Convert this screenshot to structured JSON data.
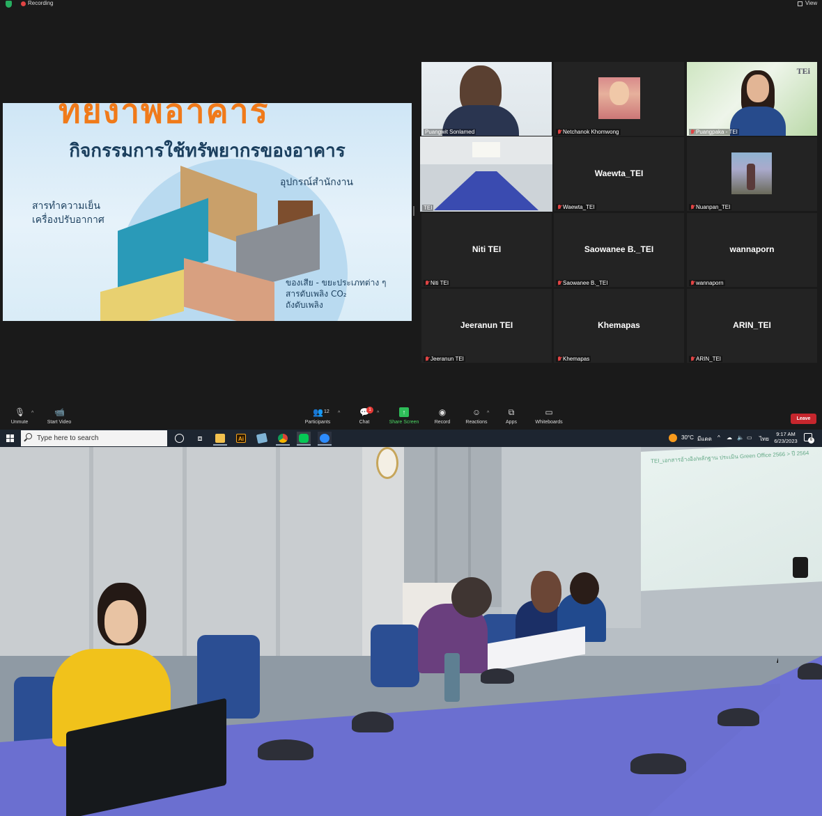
{
  "topbar": {
    "recording_label": "Recording",
    "view_label": "View"
  },
  "slide": {
    "heading": "กิจกรรมการใช้ทรัพยากรของอาคาร",
    "banner_fragment": "ทยงาพอาคาร",
    "label_office": "อุปกรณ์สำนักงาน",
    "label_refrigerant_1": "สารทำความเย็น",
    "label_refrigerant_2": "เครื่องปรับอากาศ",
    "label_waste_1": "ของเสีย - ขยะประเภทต่าง ๆ",
    "label_waste_2": "สารดับเพลิง CO₂",
    "label_waste_3": "ถังดับเพลิง"
  },
  "gallery": {
    "tiles": [
      {
        "caption": "Puangwit Sonlamed",
        "big": "",
        "muted": false
      },
      {
        "caption": "Netchanok Khomwong",
        "big": "",
        "muted": true
      },
      {
        "caption": "Puangpaka - TEI",
        "big": "",
        "muted": true
      },
      {
        "caption": "TEI",
        "big": "",
        "muted": false
      },
      {
        "caption": "Waewta_TEI",
        "big": "Waewta_TEI",
        "muted": true
      },
      {
        "caption": "Nuanpan_TEI",
        "big": "",
        "muted": true
      },
      {
        "caption": "Niti TEI",
        "big": "Niti TEI",
        "muted": true
      },
      {
        "caption": "Saowanee B._TEI",
        "big": "Saowanee B._TEI",
        "muted": true
      },
      {
        "caption": "wannaporn",
        "big": "wannaporn",
        "muted": true
      },
      {
        "caption": "Jeeranun TEI",
        "big": "Jeeranun TEI",
        "muted": true
      },
      {
        "caption": "Khemapas",
        "big": "Khemapas",
        "muted": true
      },
      {
        "caption": "ARIN_TEI",
        "big": "ARIN_TEI",
        "muted": true
      }
    ],
    "v3_logo": "TEi"
  },
  "toolbar": {
    "unmute": "Unmute",
    "start_video": "Start Video",
    "participants": "Participants",
    "participants_count": "12",
    "chat": "Chat",
    "chat_badge": "1",
    "share_screen": "Share Screen",
    "record": "Record",
    "reactions": "Reactions",
    "apps": "Apps",
    "whiteboards": "Whiteboards",
    "leave": "Leave"
  },
  "taskbar": {
    "search_placeholder": "Type here to search",
    "ai_icon_text": "Ai",
    "temperature": "30°C",
    "weather": "มีแดด",
    "language": "ไทย",
    "time": "9:17 AM",
    "date": "6/23/2023",
    "notif_count": "6"
  },
  "room": {
    "projection_title": "TEI_เอกสารอ้างอิง/หลักฐาน ประเมิน Green Office 2566  >  ปี 2564"
  },
  "colors": {
    "leave_button": "#c6262d",
    "share_screen": "#2ebd59",
    "active_speaker": "#d7e25a",
    "slide_title_orange": "#f07a1a"
  }
}
